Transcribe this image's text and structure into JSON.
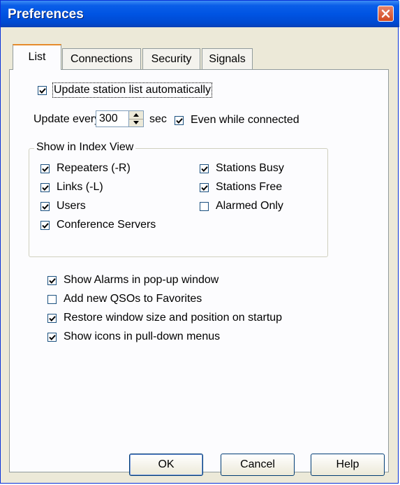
{
  "window": {
    "title": "Preferences"
  },
  "tabs": [
    {
      "label": "List",
      "active": true
    },
    {
      "label": "Connections",
      "active": false
    },
    {
      "label": "Security",
      "active": false
    },
    {
      "label": "Signals",
      "active": false
    }
  ],
  "list_tab": {
    "update_automatically": {
      "label": "Update station list automatically",
      "checked": true
    },
    "update_every_label": "Update every",
    "update_every_value": "300",
    "update_every_unit": "sec",
    "even_while_connected": {
      "label": "Even while connected",
      "checked": true
    },
    "index_view": {
      "title": "Show in Index View",
      "left": [
        {
          "label": "Repeaters (-R)",
          "checked": true
        },
        {
          "label": "Links (-L)",
          "checked": true
        },
        {
          "label": "Users",
          "checked": true
        },
        {
          "label": "Conference Servers",
          "checked": true
        }
      ],
      "right": [
        {
          "label": "Stations Busy",
          "checked": true
        },
        {
          "label": "Stations Free",
          "checked": true
        },
        {
          "label": "Alarmed Only",
          "checked": false
        }
      ]
    },
    "options": [
      {
        "label": "Show Alarms in pop-up window",
        "checked": true
      },
      {
        "label": "Add new QSOs to Favorites",
        "checked": false
      },
      {
        "label": "Restore window size and position on startup",
        "checked": true
      },
      {
        "label": "Show icons in pull-down menus",
        "checked": true
      }
    ]
  },
  "buttons": {
    "ok": "OK",
    "cancel": "Cancel",
    "help": "Help"
  }
}
